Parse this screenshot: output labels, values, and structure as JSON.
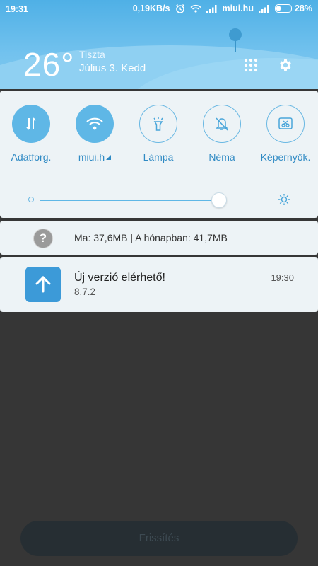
{
  "status_bar": {
    "time": "19:31",
    "speed": "0,19KB/s",
    "carrier": "miui.hu",
    "battery": "28%",
    "battery_level": 0.28
  },
  "weather": {
    "temperature": "26°",
    "condition": "Tiszta",
    "date": "Július 3. Kedd"
  },
  "toggles": [
    {
      "label": "Adatforg.",
      "icon": "data-transfer-icon",
      "active": true
    },
    {
      "label": "miui.h",
      "icon": "wifi-icon",
      "active": true
    },
    {
      "label": "Lámpa",
      "icon": "flashlight-icon",
      "active": false
    },
    {
      "label": "Néma",
      "icon": "mute-bell-icon",
      "active": false
    },
    {
      "label": "Képernyők.",
      "icon": "screenshot-icon",
      "active": false
    }
  ],
  "brightness": {
    "level": 0.77
  },
  "data_usage": {
    "text": "Ma: 37,6MB | A hónapban: 41,7MB"
  },
  "notification": {
    "title": "Új verzió elérhető!",
    "subtitle": "8.7.2",
    "time": "19:30",
    "icon": "upload-arrow-icon"
  },
  "bottom_button": {
    "label": "Frissítés"
  },
  "colors": {
    "accent": "#5fb7e6",
    "header": "#4fb0e6",
    "background": "#363636"
  }
}
